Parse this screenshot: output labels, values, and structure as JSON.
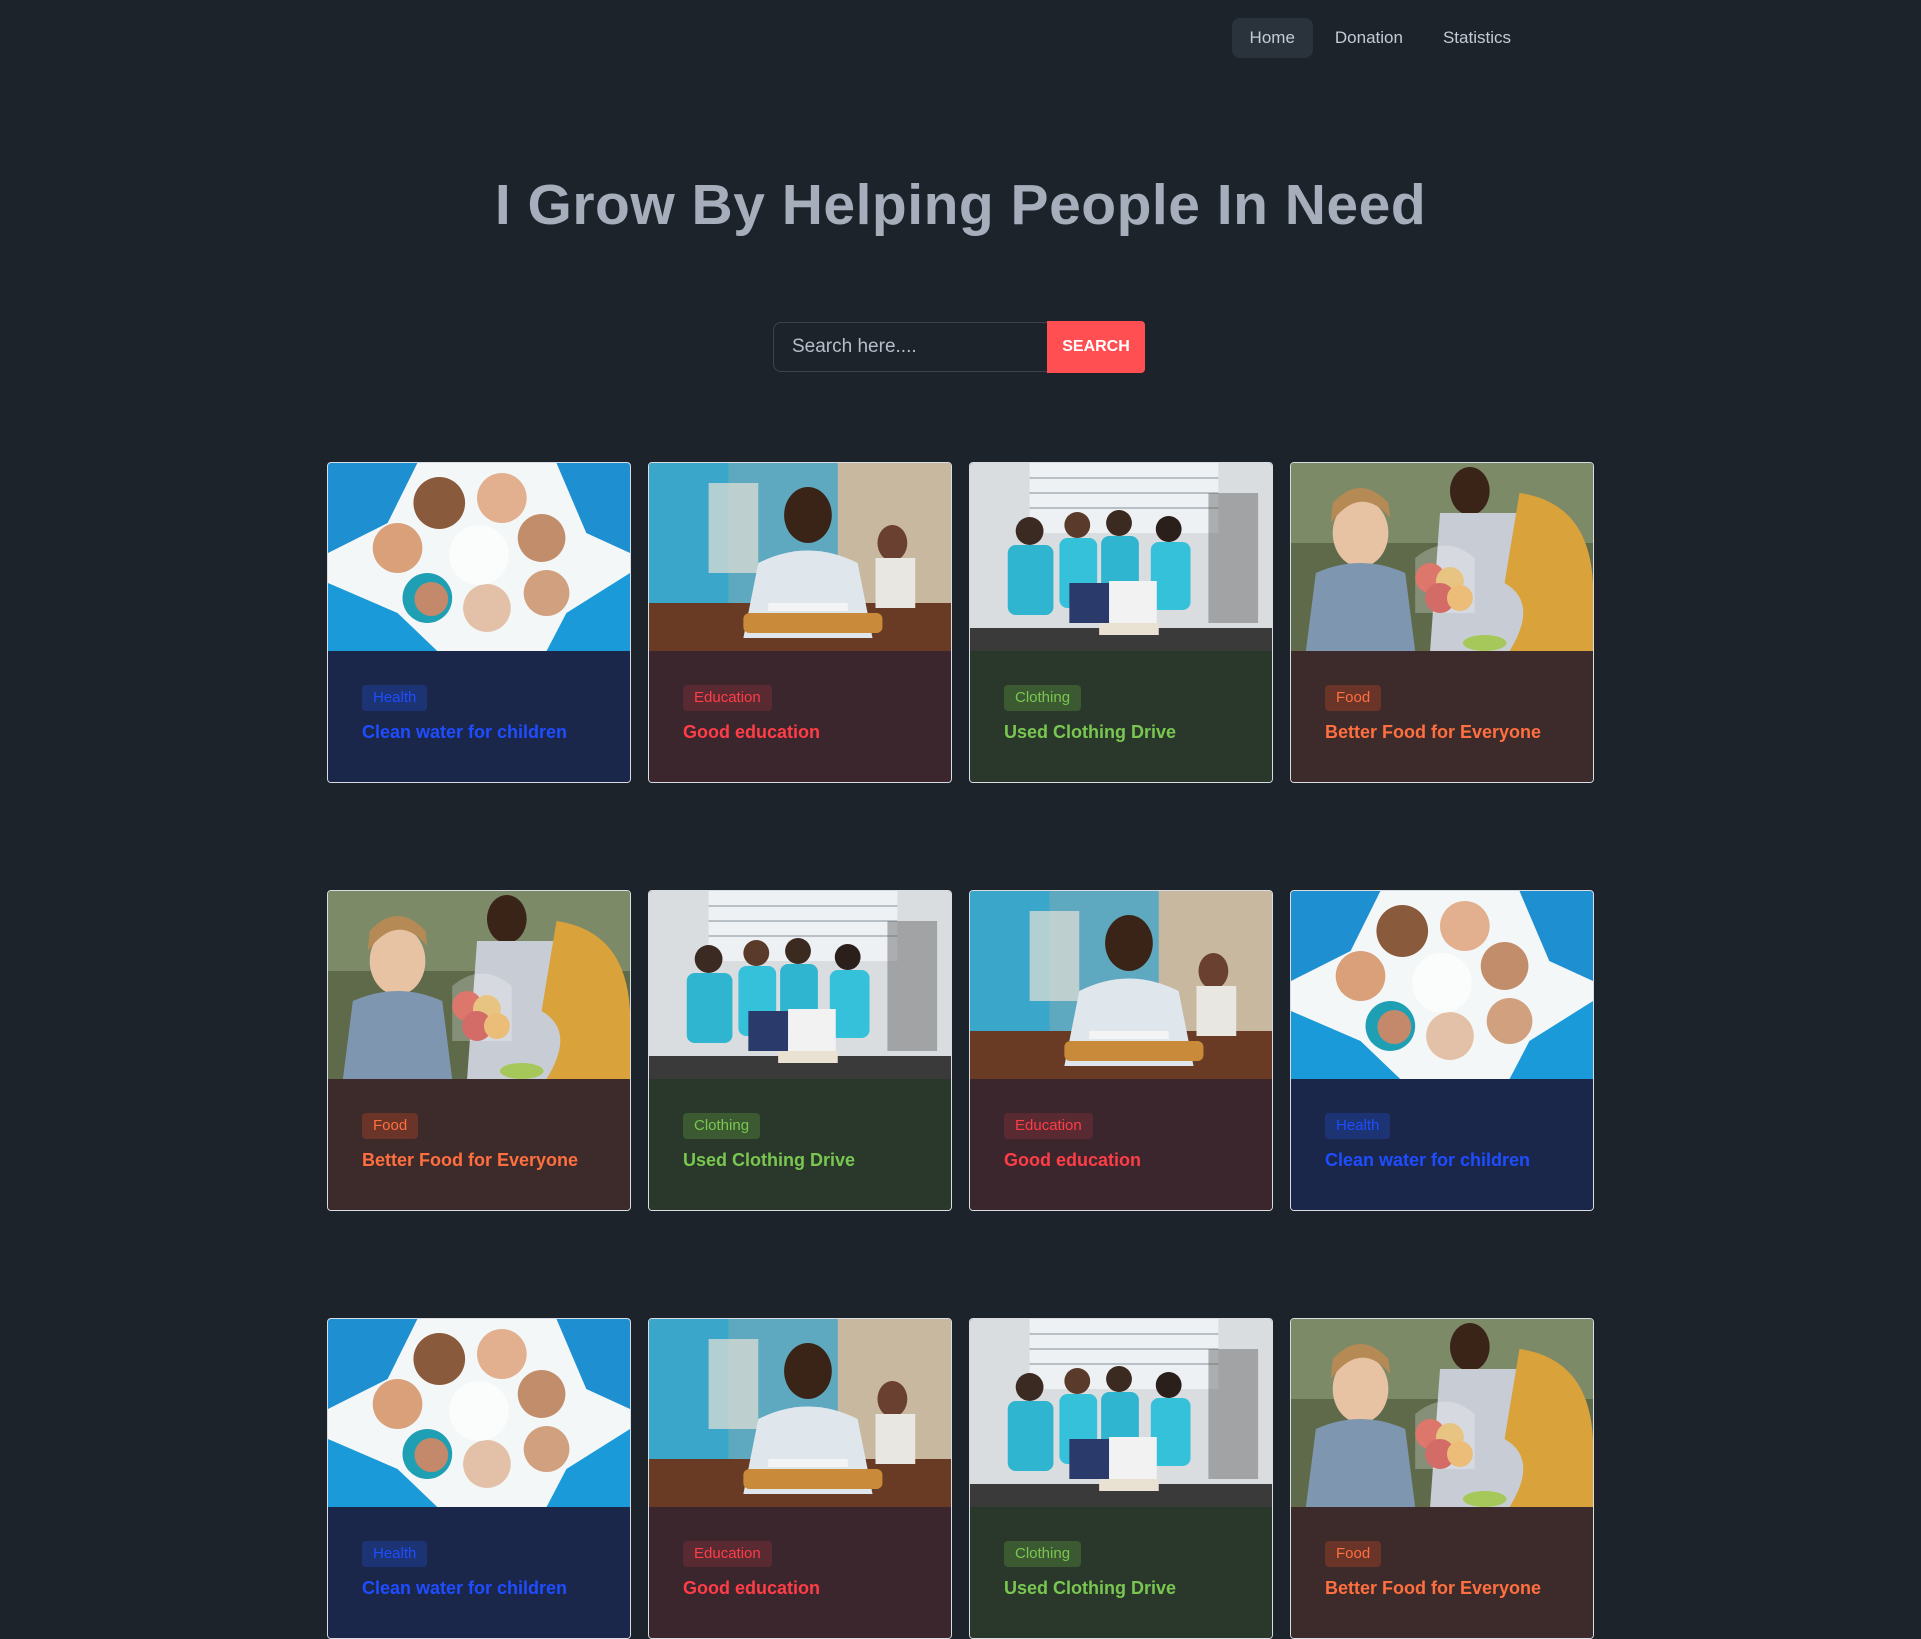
{
  "nav": {
    "items": [
      {
        "label": "Home",
        "active": true
      },
      {
        "label": "Donation",
        "active": false
      },
      {
        "label": "Statistics",
        "active": false
      }
    ]
  },
  "hero": {
    "title": "I Grow By Helping People In Need"
  },
  "search": {
    "placeholder": "Search here....",
    "value": "",
    "button_label": "SEARCH"
  },
  "colors": {
    "page_background": "#1d232a",
    "search_button": "#ff4f52",
    "health": "#1e4dff",
    "education": "#ff3d47",
    "clothing": "#79c750",
    "food": "#ff6f3f"
  },
  "cards": [
    {
      "category": "Health",
      "title": "Clean water for children",
      "theme": "health",
      "image": "volunteers-huddle-photo"
    },
    {
      "category": "Education",
      "title": "Good education",
      "theme": "education",
      "image": "student-classroom-photo"
    },
    {
      "category": "Clothing",
      "title": "Used Clothing Drive",
      "theme": "clothing",
      "image": "clothing-donation-photo"
    },
    {
      "category": "Food",
      "title": "Better Food for Everyone",
      "theme": "food",
      "image": "food-donation-photo"
    },
    {
      "category": "Food",
      "title": "Better Food for Everyone",
      "theme": "food",
      "image": "food-donation-photo"
    },
    {
      "category": "Clothing",
      "title": "Used Clothing Drive",
      "theme": "clothing",
      "image": "clothing-donation-photo"
    },
    {
      "category": "Education",
      "title": "Good education",
      "theme": "education",
      "image": "student-classroom-photo"
    },
    {
      "category": "Health",
      "title": "Clean water for children",
      "theme": "health",
      "image": "volunteers-huddle-photo"
    },
    {
      "category": "Health",
      "title": "Clean water for children",
      "theme": "health",
      "image": "volunteers-huddle-photo"
    },
    {
      "category": "Education",
      "title": "Good education",
      "theme": "education",
      "image": "student-classroom-photo"
    },
    {
      "category": "Clothing",
      "title": "Used Clothing Drive",
      "theme": "clothing",
      "image": "clothing-donation-photo"
    },
    {
      "category": "Food",
      "title": "Better Food for Everyone",
      "theme": "food",
      "image": "food-donation-photo"
    }
  ]
}
